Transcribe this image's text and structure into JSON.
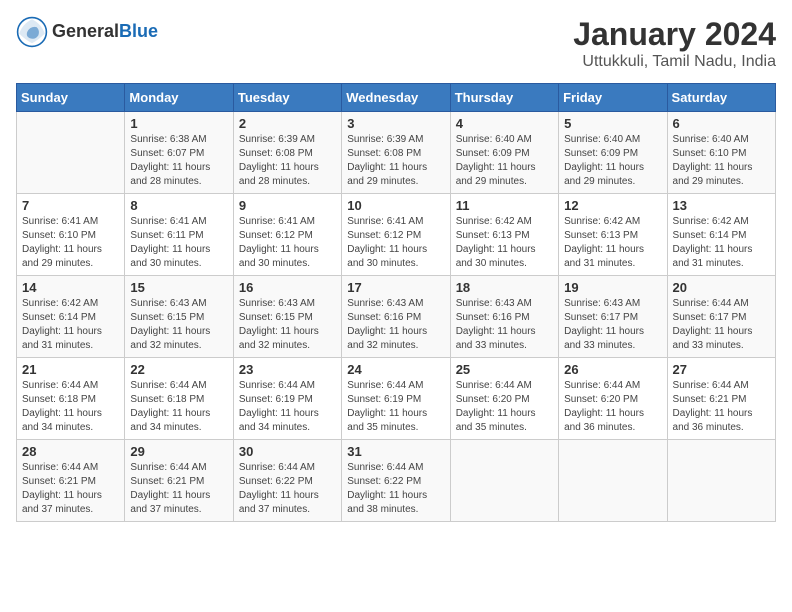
{
  "header": {
    "logo_general": "General",
    "logo_blue": "Blue",
    "main_title": "January 2024",
    "subtitle": "Uttukkuli, Tamil Nadu, India"
  },
  "days_of_week": [
    "Sunday",
    "Monday",
    "Tuesday",
    "Wednesday",
    "Thursday",
    "Friday",
    "Saturday"
  ],
  "weeks": [
    [
      {
        "day": "",
        "sunrise": "",
        "sunset": "",
        "daylight": ""
      },
      {
        "day": "1",
        "sunrise": "Sunrise: 6:38 AM",
        "sunset": "Sunset: 6:07 PM",
        "daylight": "Daylight: 11 hours and 28 minutes."
      },
      {
        "day": "2",
        "sunrise": "Sunrise: 6:39 AM",
        "sunset": "Sunset: 6:08 PM",
        "daylight": "Daylight: 11 hours and 28 minutes."
      },
      {
        "day": "3",
        "sunrise": "Sunrise: 6:39 AM",
        "sunset": "Sunset: 6:08 PM",
        "daylight": "Daylight: 11 hours and 29 minutes."
      },
      {
        "day": "4",
        "sunrise": "Sunrise: 6:40 AM",
        "sunset": "Sunset: 6:09 PM",
        "daylight": "Daylight: 11 hours and 29 minutes."
      },
      {
        "day": "5",
        "sunrise": "Sunrise: 6:40 AM",
        "sunset": "Sunset: 6:09 PM",
        "daylight": "Daylight: 11 hours and 29 minutes."
      },
      {
        "day": "6",
        "sunrise": "Sunrise: 6:40 AM",
        "sunset": "Sunset: 6:10 PM",
        "daylight": "Daylight: 11 hours and 29 minutes."
      }
    ],
    [
      {
        "day": "7",
        "sunrise": "Sunrise: 6:41 AM",
        "sunset": "Sunset: 6:10 PM",
        "daylight": "Daylight: 11 hours and 29 minutes."
      },
      {
        "day": "8",
        "sunrise": "Sunrise: 6:41 AM",
        "sunset": "Sunset: 6:11 PM",
        "daylight": "Daylight: 11 hours and 30 minutes."
      },
      {
        "day": "9",
        "sunrise": "Sunrise: 6:41 AM",
        "sunset": "Sunset: 6:12 PM",
        "daylight": "Daylight: 11 hours and 30 minutes."
      },
      {
        "day": "10",
        "sunrise": "Sunrise: 6:41 AM",
        "sunset": "Sunset: 6:12 PM",
        "daylight": "Daylight: 11 hours and 30 minutes."
      },
      {
        "day": "11",
        "sunrise": "Sunrise: 6:42 AM",
        "sunset": "Sunset: 6:13 PM",
        "daylight": "Daylight: 11 hours and 30 minutes."
      },
      {
        "day": "12",
        "sunrise": "Sunrise: 6:42 AM",
        "sunset": "Sunset: 6:13 PM",
        "daylight": "Daylight: 11 hours and 31 minutes."
      },
      {
        "day": "13",
        "sunrise": "Sunrise: 6:42 AM",
        "sunset": "Sunset: 6:14 PM",
        "daylight": "Daylight: 11 hours and 31 minutes."
      }
    ],
    [
      {
        "day": "14",
        "sunrise": "Sunrise: 6:42 AM",
        "sunset": "Sunset: 6:14 PM",
        "daylight": "Daylight: 11 hours and 31 minutes."
      },
      {
        "day": "15",
        "sunrise": "Sunrise: 6:43 AM",
        "sunset": "Sunset: 6:15 PM",
        "daylight": "Daylight: 11 hours and 32 minutes."
      },
      {
        "day": "16",
        "sunrise": "Sunrise: 6:43 AM",
        "sunset": "Sunset: 6:15 PM",
        "daylight": "Daylight: 11 hours and 32 minutes."
      },
      {
        "day": "17",
        "sunrise": "Sunrise: 6:43 AM",
        "sunset": "Sunset: 6:16 PM",
        "daylight": "Daylight: 11 hours and 32 minutes."
      },
      {
        "day": "18",
        "sunrise": "Sunrise: 6:43 AM",
        "sunset": "Sunset: 6:16 PM",
        "daylight": "Daylight: 11 hours and 33 minutes."
      },
      {
        "day": "19",
        "sunrise": "Sunrise: 6:43 AM",
        "sunset": "Sunset: 6:17 PM",
        "daylight": "Daylight: 11 hours and 33 minutes."
      },
      {
        "day": "20",
        "sunrise": "Sunrise: 6:44 AM",
        "sunset": "Sunset: 6:17 PM",
        "daylight": "Daylight: 11 hours and 33 minutes."
      }
    ],
    [
      {
        "day": "21",
        "sunrise": "Sunrise: 6:44 AM",
        "sunset": "Sunset: 6:18 PM",
        "daylight": "Daylight: 11 hours and 34 minutes."
      },
      {
        "day": "22",
        "sunrise": "Sunrise: 6:44 AM",
        "sunset": "Sunset: 6:18 PM",
        "daylight": "Daylight: 11 hours and 34 minutes."
      },
      {
        "day": "23",
        "sunrise": "Sunrise: 6:44 AM",
        "sunset": "Sunset: 6:19 PM",
        "daylight": "Daylight: 11 hours and 34 minutes."
      },
      {
        "day": "24",
        "sunrise": "Sunrise: 6:44 AM",
        "sunset": "Sunset: 6:19 PM",
        "daylight": "Daylight: 11 hours and 35 minutes."
      },
      {
        "day": "25",
        "sunrise": "Sunrise: 6:44 AM",
        "sunset": "Sunset: 6:20 PM",
        "daylight": "Daylight: 11 hours and 35 minutes."
      },
      {
        "day": "26",
        "sunrise": "Sunrise: 6:44 AM",
        "sunset": "Sunset: 6:20 PM",
        "daylight": "Daylight: 11 hours and 36 minutes."
      },
      {
        "day": "27",
        "sunrise": "Sunrise: 6:44 AM",
        "sunset": "Sunset: 6:21 PM",
        "daylight": "Daylight: 11 hours and 36 minutes."
      }
    ],
    [
      {
        "day": "28",
        "sunrise": "Sunrise: 6:44 AM",
        "sunset": "Sunset: 6:21 PM",
        "daylight": "Daylight: 11 hours and 37 minutes."
      },
      {
        "day": "29",
        "sunrise": "Sunrise: 6:44 AM",
        "sunset": "Sunset: 6:21 PM",
        "daylight": "Daylight: 11 hours and 37 minutes."
      },
      {
        "day": "30",
        "sunrise": "Sunrise: 6:44 AM",
        "sunset": "Sunset: 6:22 PM",
        "daylight": "Daylight: 11 hours and 37 minutes."
      },
      {
        "day": "31",
        "sunrise": "Sunrise: 6:44 AM",
        "sunset": "Sunset: 6:22 PM",
        "daylight": "Daylight: 11 hours and 38 minutes."
      },
      {
        "day": "",
        "sunrise": "",
        "sunset": "",
        "daylight": ""
      },
      {
        "day": "",
        "sunrise": "",
        "sunset": "",
        "daylight": ""
      },
      {
        "day": "",
        "sunrise": "",
        "sunset": "",
        "daylight": ""
      }
    ]
  ]
}
